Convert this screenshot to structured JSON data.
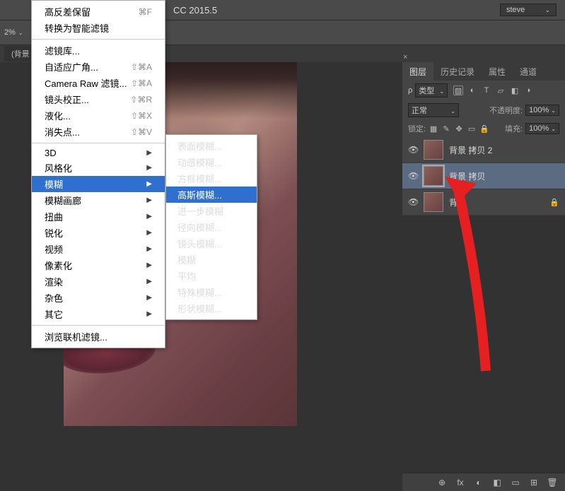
{
  "app_title": "CC 2015.5",
  "user_select": "steve",
  "zoom_pct": "2%",
  "doc_tab": "(背景 持",
  "menu": {
    "items": [
      {
        "label": "高反差保留",
        "shortcut": "⌘F",
        "sub": false
      },
      {
        "label": "转换为智能滤镜",
        "shortcut": "",
        "sub": false
      },
      {
        "sep": true
      },
      {
        "label": "滤镜库...",
        "shortcut": "",
        "sub": false
      },
      {
        "label": "自适应广角...",
        "shortcut": "⇧⌘A",
        "sub": false
      },
      {
        "label": "Camera Raw 滤镜...",
        "shortcut": "⇧⌘A",
        "sub": false
      },
      {
        "label": "镜头校正...",
        "shortcut": "⇧⌘R",
        "sub": false
      },
      {
        "label": "液化...",
        "shortcut": "⇧⌘X",
        "sub": false
      },
      {
        "label": "消失点...",
        "shortcut": "⇧⌘V",
        "sub": false
      },
      {
        "sep": true
      },
      {
        "label": "3D",
        "shortcut": "",
        "sub": true
      },
      {
        "label": "风格化",
        "shortcut": "",
        "sub": true
      },
      {
        "label": "模糊",
        "shortcut": "",
        "sub": true,
        "selected": true
      },
      {
        "label": "模糊画廊",
        "shortcut": "",
        "sub": true
      },
      {
        "label": "扭曲",
        "shortcut": "",
        "sub": true
      },
      {
        "label": "锐化",
        "shortcut": "",
        "sub": true
      },
      {
        "label": "视频",
        "shortcut": "",
        "sub": true
      },
      {
        "label": "像素化",
        "shortcut": "",
        "sub": true
      },
      {
        "label": "渲染",
        "shortcut": "",
        "sub": true
      },
      {
        "label": "杂色",
        "shortcut": "",
        "sub": true
      },
      {
        "label": "其它",
        "shortcut": "",
        "sub": true
      },
      {
        "sep": true
      },
      {
        "label": "浏览联机滤镜...",
        "shortcut": "",
        "sub": false
      }
    ]
  },
  "submenu": {
    "items": [
      {
        "label": "表面模糊..."
      },
      {
        "label": "动感模糊..."
      },
      {
        "label": "方框模糊..."
      },
      {
        "label": "高斯模糊...",
        "selected": true
      },
      {
        "label": "进一步模糊"
      },
      {
        "label": "径向模糊..."
      },
      {
        "label": "镜头模糊..."
      },
      {
        "label": "模糊"
      },
      {
        "label": "平均"
      },
      {
        "label": "特殊模糊..."
      },
      {
        "label": "形状模糊..."
      }
    ]
  },
  "panel": {
    "close": "×",
    "tabs": [
      "图层",
      "历史记录",
      "属性",
      "通道"
    ],
    "active_tab": 0,
    "type_label": "类型",
    "search_glyph": "ρ",
    "blend_mode": "正常",
    "opacity_label": "不透明度:",
    "opacity_value": "100%",
    "lock_label": "锁定:",
    "fill_label": "填充:",
    "fill_value": "100%",
    "layers": [
      {
        "name": "背景 拷贝 2",
        "visible": true,
        "selected": false,
        "locked": false
      },
      {
        "name": "背景 拷贝",
        "visible": true,
        "selected": true,
        "locked": false
      },
      {
        "name": "背景",
        "visible": true,
        "selected": false,
        "locked": true
      }
    ]
  },
  "layer_bottom_icons": [
    "⊕",
    "fx",
    "◐",
    "◧",
    "▭",
    "⊞",
    "🗑"
  ]
}
